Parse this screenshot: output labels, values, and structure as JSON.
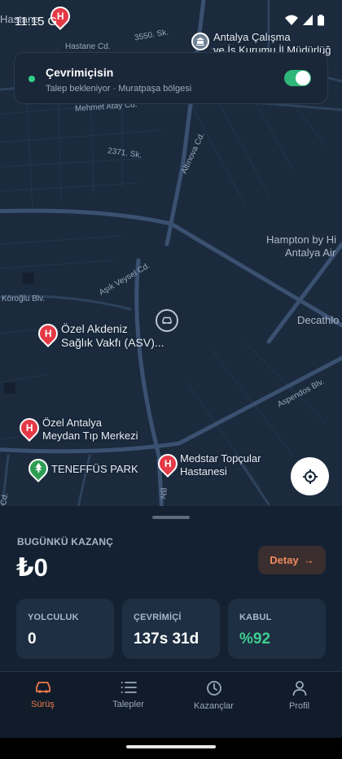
{
  "status_bar": {
    "time": "11:15",
    "carrier_glyph": "G"
  },
  "map": {
    "labels": {
      "hastane_top": "Hastane",
      "hastane_cd": "Hastane Cd.",
      "street_3550": "3550. Sk.",
      "mehmet_atay": "Mehmet Atay Cd.",
      "street_2371": "2371. Sk.",
      "altinova": "Altınova Cd.",
      "asik_veysel": "Aşık Veysel Cd.",
      "koroglu": "Köroğlu Blv.",
      "aspendos": "Aspendos Blv.",
      "blv_vertical": "Blv.",
      "cd_left": "Cd.",
      "hampton": "Hampton by Hi",
      "antalya_air": "Antalya Air",
      "decathlon": "Decathlo"
    },
    "pois": {
      "calisma": {
        "line1": "Antalya Çalışma",
        "line2": "ve İş Kurumu İl Müdürlüğ",
        "icon": "government-icon"
      },
      "akdeniz": {
        "line1": "Özel Akdeniz",
        "line2": "Sağlık Vakfı (ASV)...",
        "icon": "hospital-icon"
      },
      "meydan": {
        "line1": "Özel Antalya",
        "line2": "Meydan Tıp Merkezi",
        "icon": "hospital-icon"
      },
      "teneffus": {
        "line1": "TENEFFÜS PARK",
        "icon": "park-icon"
      },
      "medstar": {
        "line1": "Medstar Topçular",
        "line2": "Hastanesi",
        "icon": "hospital-icon"
      }
    },
    "pin_letter": "H"
  },
  "online_card": {
    "title": "Çevrimiçisin",
    "subtitle": "Talep bekleniyor · Muratpaşa bölgesi",
    "toggle_on": true,
    "accent": "#31d18a"
  },
  "earnings": {
    "label": "BUGÜNKÜ KAZANÇ",
    "value": "₺0",
    "detail_button": "Detay"
  },
  "stats": [
    {
      "label": "YOLCULUK",
      "value": "0"
    },
    {
      "label": "ÇEVRİMİÇİ",
      "value": "137s 31d"
    },
    {
      "label": "KABUL",
      "value": "%92"
    }
  ],
  "nav": [
    {
      "label": "Sürüş",
      "icon": "car-icon",
      "active": true
    },
    {
      "label": "Talepler",
      "icon": "list-icon",
      "active": false
    },
    {
      "label": "Kazançlar",
      "icon": "clock-icon",
      "active": false
    },
    {
      "label": "Profil",
      "icon": "user-icon",
      "active": false
    }
  ],
  "colors": {
    "accent_orange": "#ef7a4a",
    "green": "#3ecf8e",
    "hospital_red": "#e53946",
    "park_green": "#2e9e55"
  }
}
